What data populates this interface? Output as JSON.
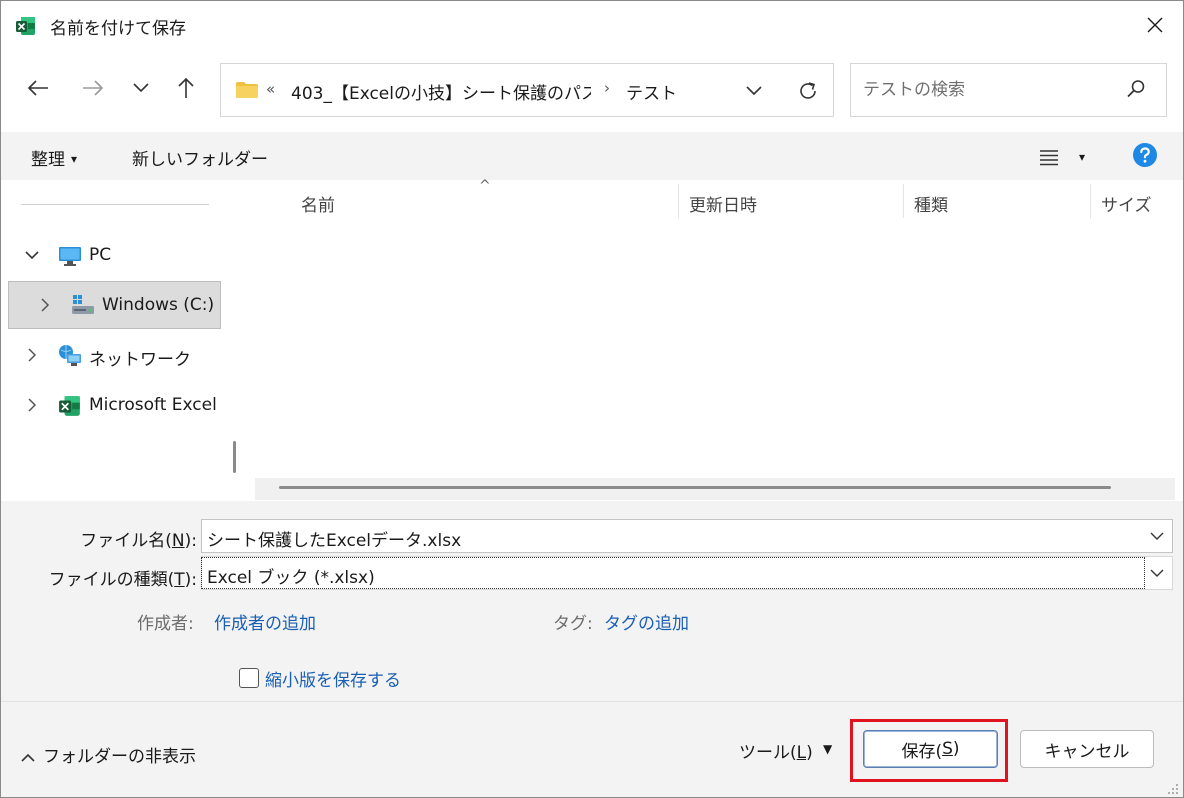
{
  "window": {
    "title": "名前を付けて保存",
    "app_icon": "excel-icon",
    "close_icon": "close-icon"
  },
  "nav": {
    "back_icon": "arrow-left-icon",
    "forward_icon": "arrow-right-icon",
    "recent_icon": "chevron-down-icon",
    "up_icon": "arrow-up-icon",
    "address": {
      "overflow_chevron": "«",
      "segment1": "403_【Excelの小技】シート保護のパスワ...",
      "separator": "›",
      "segment2": "テスト",
      "dropdown_icon": "chevron-down-icon",
      "refresh_icon": "refresh-icon"
    },
    "search": {
      "placeholder": "テストの検索",
      "value": "",
      "icon": "search-icon"
    }
  },
  "toolbar": {
    "organize_label": "整理",
    "organize_arrow": "▾",
    "new_folder_label": "新しいフォルダー",
    "view_icon": "list-view-icon",
    "view_dropdown": "▾",
    "help_icon": "help-icon"
  },
  "tree": {
    "items": [
      {
        "label": "PC",
        "expanded": true,
        "icon": "pc-monitor-icon"
      },
      {
        "label": "Windows (C:)",
        "expanded": false,
        "selected": true,
        "icon": "drive-icon"
      },
      {
        "label": "ネットワーク",
        "expanded": false,
        "icon": "network-icon"
      },
      {
        "label": "Microsoft Excel",
        "expanded": false,
        "icon": "excel-icon"
      }
    ]
  },
  "file_list": {
    "columns": [
      "名前",
      "更新日時",
      "種類",
      "サイズ"
    ],
    "sort_indicator": "^",
    "rows": []
  },
  "details": {
    "filename_label": "ファイル名(",
    "filename_key": "N",
    "filename_label_end": "):",
    "filename_value": "シート保護したExcelデータ.xlsx",
    "type_label": "ファイルの種類(",
    "type_key": "T",
    "type_label_end": "):",
    "type_value": "Excel ブック (*.xlsx)",
    "author_label": "作成者:",
    "author_link": "作成者の追加",
    "tags_label": "タグ:",
    "tags_link": "タグの追加",
    "thumbnail_label": "縮小版を保存する",
    "thumbnail_checked": false
  },
  "footer": {
    "hide_folders_label": "フォルダーの非表示",
    "tools_label": "ツール(",
    "tools_key": "L",
    "tools_label_end": ")",
    "tools_arrow": "▼",
    "save_label": "保存(",
    "save_key": "S",
    "save_label_end": ")",
    "cancel_label": "キャンセル"
  },
  "colors": {
    "accent": "#1a5fb4",
    "highlight": "#e0141e",
    "help": "#1e88e5",
    "excel_green": "#1d7044",
    "folder_yellow": "#f0c040"
  }
}
